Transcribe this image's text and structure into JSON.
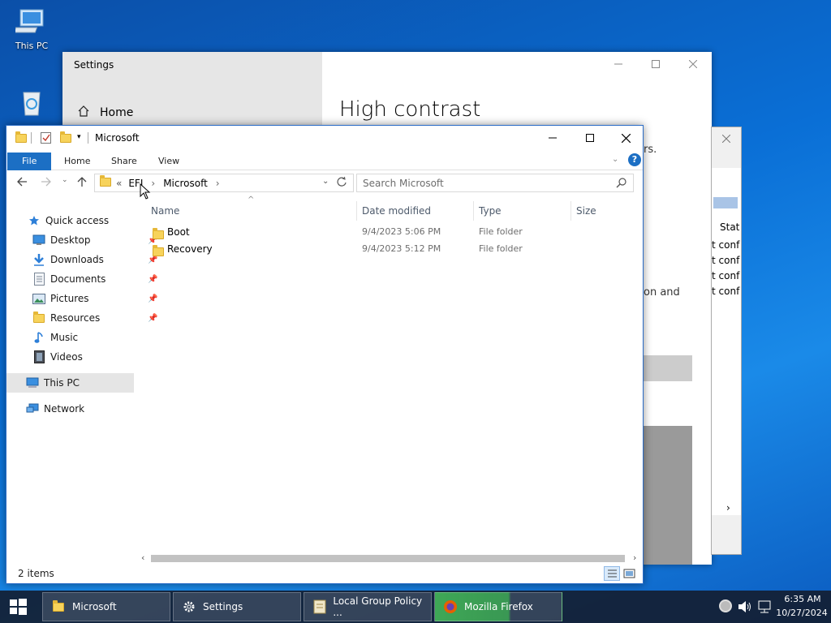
{
  "desktop": {
    "icons": [
      {
        "label": "This PC",
        "icon": "computer-icon"
      },
      {
        "label": "",
        "icon": "recycle-bin-icon"
      }
    ]
  },
  "settings": {
    "title": "Settings",
    "home_label": "Home",
    "heading": "High contrast",
    "partial_text_1": "rs.",
    "partial_text_2": "on and"
  },
  "third_window": {
    "header": "Stat",
    "rows": [
      "t conf",
      "t conf",
      "t conf",
      "t conf"
    ]
  },
  "explorer": {
    "title": "Microsoft",
    "ribbon_tabs": [
      "File",
      "Home",
      "Share",
      "View"
    ],
    "breadcrumb": [
      "EFI",
      "Microsoft"
    ],
    "breadcrumb_prefix": "«",
    "search_placeholder": "Search Microsoft",
    "columns": [
      "Name",
      "Date modified",
      "Type",
      "Size"
    ],
    "files": [
      {
        "name": "Boot",
        "date": "9/4/2023 5:06 PM",
        "type": "File folder",
        "size": ""
      },
      {
        "name": "Recovery",
        "date": "9/4/2023 5:12 PM",
        "type": "File folder",
        "size": ""
      }
    ],
    "nav": {
      "quick_access": "Quick access",
      "items": [
        {
          "label": "Desktop",
          "icon": "desktop-icon",
          "pinned": true
        },
        {
          "label": "Downloads",
          "icon": "downloads-icon",
          "pinned": true
        },
        {
          "label": "Documents",
          "icon": "documents-icon",
          "pinned": true
        },
        {
          "label": "Pictures",
          "icon": "pictures-icon",
          "pinned": true
        },
        {
          "label": "Resources",
          "icon": "folder-icon",
          "pinned": true
        },
        {
          "label": "Music",
          "icon": "music-icon",
          "pinned": false
        },
        {
          "label": "Videos",
          "icon": "videos-icon",
          "pinned": false
        }
      ],
      "this_pc": "This PC",
      "network": "Network"
    },
    "status": "2 items"
  },
  "taskbar": {
    "items": [
      {
        "label": "Microsoft",
        "icon": "folder-icon"
      },
      {
        "label": "Settings",
        "icon": "gear-icon"
      },
      {
        "label": "Local Group Policy ...",
        "icon": "policy-icon"
      },
      {
        "label": "Mozilla Firefox",
        "icon": "firefox-icon"
      }
    ],
    "time": "6:35 AM",
    "date": "10/27/2024"
  },
  "colors": {
    "accent": "#1c6fc4",
    "file_tab": "#1c6fc4",
    "folder": "#f7d35b",
    "selection": "#e5e5e5"
  }
}
